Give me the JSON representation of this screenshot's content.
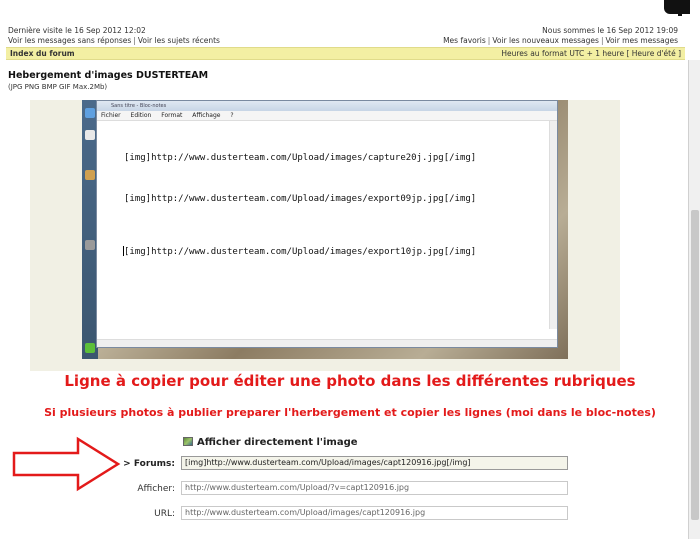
{
  "header": {
    "last_visit": "Dernière visite le 16 Sep 2012 12:02",
    "now": "Nous sommes le 16 Sep 2012 19:09",
    "links_left": [
      "Voir les messages sans réponses",
      "Voir les sujets récents"
    ],
    "links_right": [
      "Mes favoris",
      "Voir les nouveaux messages",
      "Voir mes messages"
    ]
  },
  "navbar": {
    "index_label": "Index du forum",
    "timezone": "Heures au format UTC + 1 heure [ Heure d'été ]"
  },
  "page": {
    "title": "Hebergement d'images DUSTERTEAM",
    "subtitle": "(JPG PNG BMP GIF Max.2Mb)"
  },
  "notepad": {
    "title": "Sans titre - Bloc-notes",
    "menu": [
      "Fichier",
      "Edition",
      "Format",
      "Affichage",
      "?"
    ],
    "lines": [
      "[img]http://www.dusterteam.com/Upload/images/capture20j.jpg[/img]",
      "[img]http://www.dusterteam.com/Upload/images/export09jp.jpg[/img]",
      "[img]http://www.dusterteam.com/Upload/images/export10jp.jpg[/img]"
    ]
  },
  "annotations": {
    "main": "Ligne à copier pour éditer une photo dans les différentes rubriques",
    "sub": "Si plusieurs photos à publier preparer l'herbergement et copier les lignes (moi dans le bloc-notes)"
  },
  "form": {
    "display_label": "Afficher directement l'image",
    "fields": [
      {
        "label": "> Forums:",
        "value": "[img]http://www.dusterteam.com/Upload/images/capt120916.jpg[/img]"
      },
      {
        "label": "Afficher:",
        "value": "http://www.dusterteam.com/Upload/?v=capt120916.jpg"
      },
      {
        "label": "URL:",
        "value": "http://www.dusterteam.com/Upload/images/capt120916.jpg"
      }
    ]
  },
  "colors": {
    "annotation_red": "#e31a1a",
    "navbar_yellow": "#f3efa3"
  }
}
